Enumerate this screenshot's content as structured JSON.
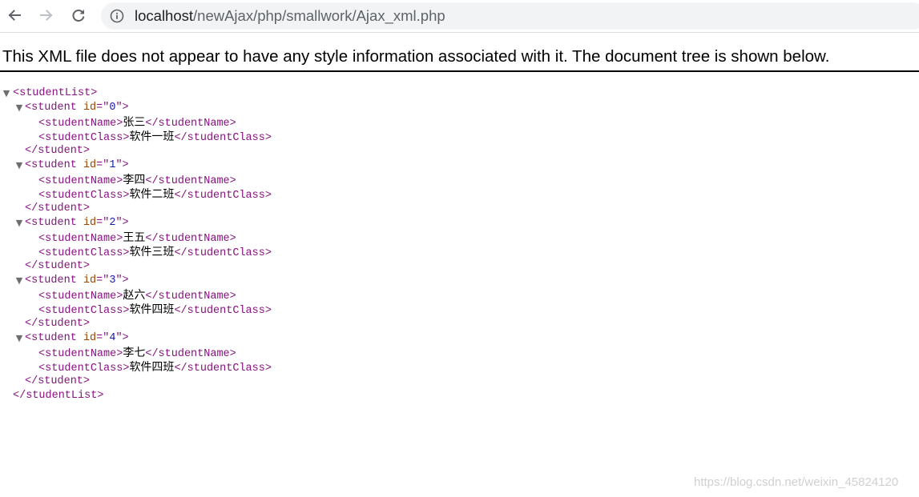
{
  "browser": {
    "url_host": "localhost",
    "url_path": "/newAjax/php/smallwork/Ajax_xml.php"
  },
  "page": {
    "notice": "This XML file does not appear to have any style information associated with it. The document tree is shown below."
  },
  "xml": {
    "root_tag": "studentList",
    "student_tag": "student",
    "attr_name": "id",
    "name_tag": "studentName",
    "class_tag": "studentClass",
    "students": [
      {
        "id": "0",
        "name": "张三",
        "class": "软件一班"
      },
      {
        "id": "1",
        "name": "李四",
        "class": "软件二班"
      },
      {
        "id": "2",
        "name": "王五",
        "class": "软件三班"
      },
      {
        "id": "3",
        "name": "赵六",
        "class": "软件四班"
      },
      {
        "id": "4",
        "name": "李七",
        "class": "软件四班"
      }
    ]
  },
  "watermark": "https://blog.csdn.net/weixin_45824120",
  "icons": {
    "back": "arrow-left-icon",
    "forward": "arrow-right-icon",
    "reload": "reload-icon",
    "info": "info-circle-icon",
    "collapse": "triangle-down-icon"
  },
  "colors": {
    "tag": "#881280",
    "attribute": "#994500",
    "value": "#1a1aa6"
  }
}
